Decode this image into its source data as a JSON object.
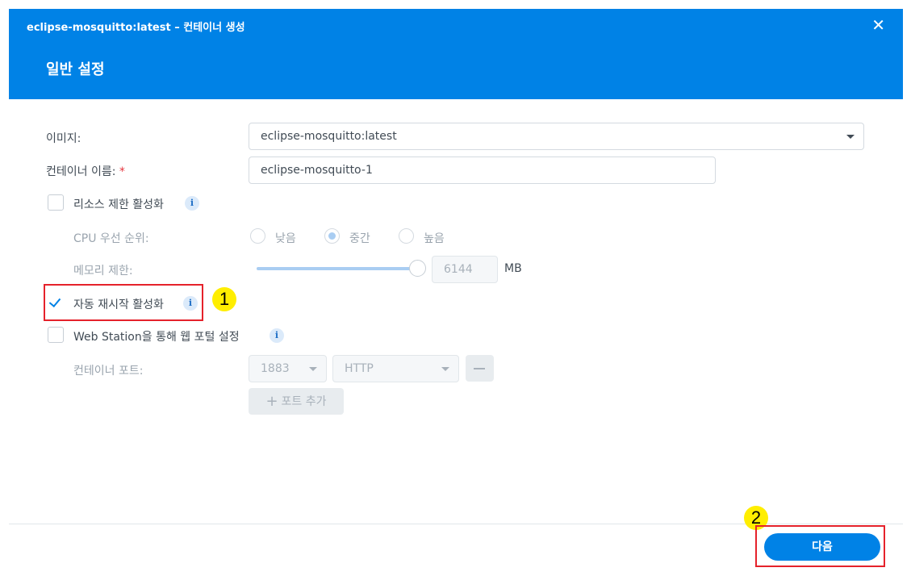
{
  "window": {
    "title": "eclipse-mosquitto:latest – 컨테이너 생성",
    "close_label": "✕"
  },
  "page_title": "일반 설정",
  "image": {
    "label": "이미지:",
    "value": "eclipse-mosquitto:latest"
  },
  "container_name": {
    "label": "컨테이너 이름:",
    "required_mark": "*",
    "value": "eclipse-mosquitto-1"
  },
  "resource_limit": {
    "label": "리소스 제한 활성화",
    "checked": false
  },
  "cpu_priority": {
    "label": "CPU 우선 순위:",
    "options": [
      "낮음",
      "중간",
      "높음"
    ],
    "selected": "중간"
  },
  "memory_limit": {
    "label": "메모리 제한:",
    "value": "6144",
    "unit": "MB",
    "slider_fraction": 1.0
  },
  "auto_restart": {
    "label": "자동 재시작 활성화",
    "checked": true
  },
  "web_portal": {
    "label": "Web Station을 통해 웹 포털 설정",
    "checked": false
  },
  "container_port": {
    "label": "컨테이너 포트:",
    "port": "1883",
    "protocol": "HTTP"
  },
  "add_port_label": "포트 추가",
  "info_glyph": "i",
  "callouts": [
    "1",
    "2"
  ],
  "next_label": "다음",
  "colors": {
    "accent": "#0082e6",
    "highlight_box": "#e5222b",
    "callout": "#ffee00"
  }
}
